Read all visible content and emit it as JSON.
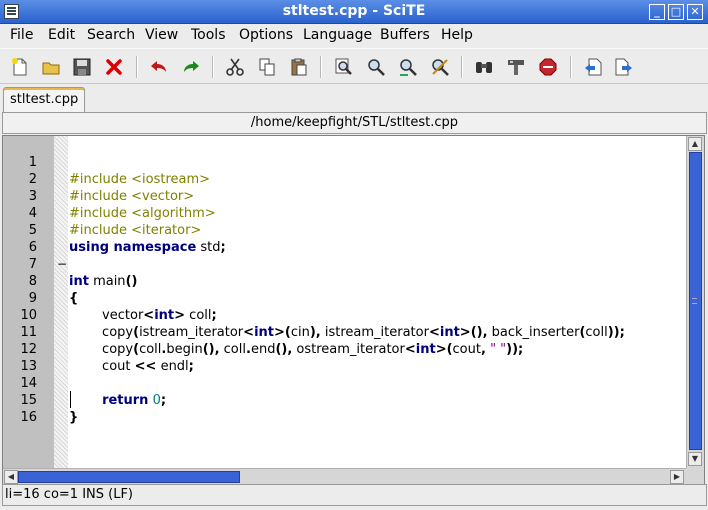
{
  "window": {
    "title": "stltest.cpp - SciTE"
  },
  "menu": [
    {
      "label": "File"
    },
    {
      "label": "Edit"
    },
    {
      "label": "Search"
    },
    {
      "label": "View"
    },
    {
      "label": "Tools"
    },
    {
      "label": "Options"
    },
    {
      "label": "Language"
    },
    {
      "label": "Buffers"
    },
    {
      "label": "Help"
    }
  ],
  "toolbar": {
    "icons": [
      "new-file-icon",
      "open-folder-icon",
      "save-icon",
      "close-icon",
      "undo-icon",
      "redo-icon",
      "cut-icon",
      "copy-icon",
      "paste-icon",
      "find-icon",
      "find-next-icon",
      "find-previous-icon",
      "replace-icon",
      "binoculars-icon",
      "build-icon",
      "stop-icon",
      "prev-buffer-icon",
      "next-buffer-icon"
    ]
  },
  "tabs": [
    {
      "label": "stltest.cpp"
    }
  ],
  "path": "/home/keepfight/STL/stltest.cpp",
  "editor": {
    "line_numbers": [
      "1",
      "2",
      "3",
      "4",
      "5",
      "6",
      "7",
      "8",
      "9",
      "10",
      "11",
      "12",
      "13",
      "14",
      "15",
      "16"
    ]
  },
  "status": "li=16 co=1 INS (LF)",
  "colors": {
    "preprocessor": "#808000",
    "keyword": "#00007f",
    "string": "#7f007f",
    "number": "#007f7f",
    "scrollbar_thumb": "#3a63d8",
    "titlebar": "#2a62cf"
  }
}
